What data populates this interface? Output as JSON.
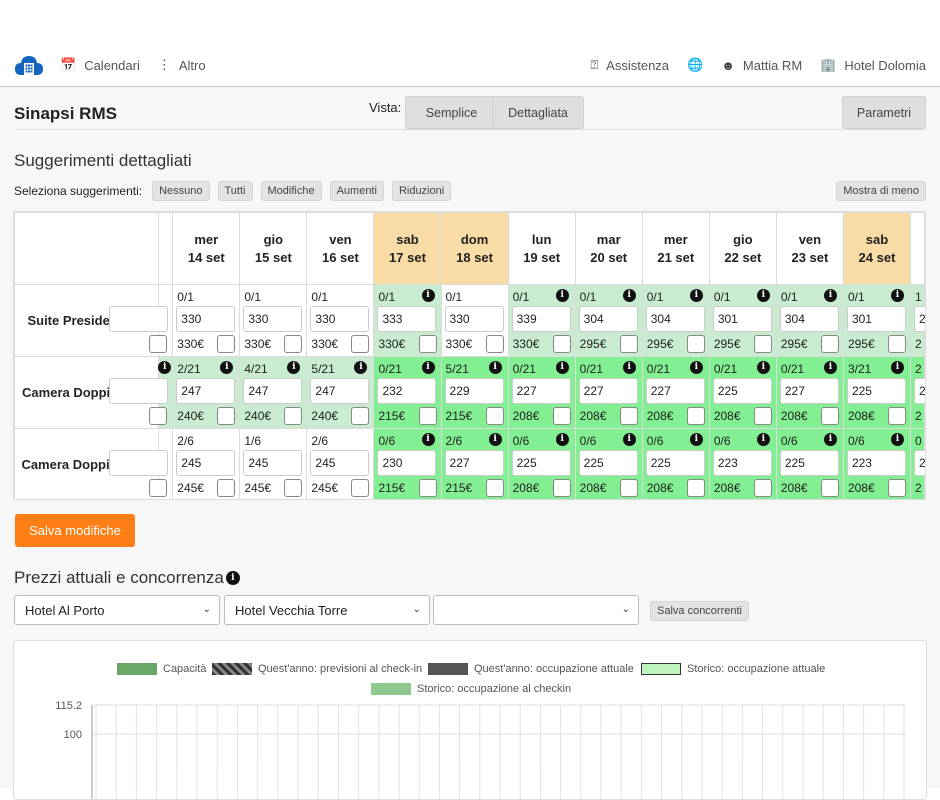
{
  "nav": {
    "calendari": "Calendari",
    "altro": "Altro",
    "assistenza": "Assistenza",
    "user": "Mattia RM",
    "hotel": "Hotel Dolomia"
  },
  "header": {
    "title": "Sinapsi RMS",
    "vista_label": "Vista:",
    "semplice": "Semplice",
    "dettagliata": "Dettagliata",
    "parametri": "Parametri"
  },
  "suggestions": {
    "title": "Suggerimenti dettagliati",
    "select_label": "Seleziona suggerimenti:",
    "filters": [
      "Nessuno",
      "Tutti",
      "Modifiche",
      "Aumenti",
      "Riduzioni"
    ],
    "show_less": "Mostra di meno"
  },
  "days": [
    {
      "dow": "mer",
      "date": "14 set",
      "weekend": false
    },
    {
      "dow": "gio",
      "date": "15 set",
      "weekend": false
    },
    {
      "dow": "ven",
      "date": "16 set",
      "weekend": false
    },
    {
      "dow": "sab",
      "date": "17 set",
      "weekend": true
    },
    {
      "dow": "dom",
      "date": "18 set",
      "weekend": true
    },
    {
      "dow": "lun",
      "date": "19 set",
      "weekend": false
    },
    {
      "dow": "mar",
      "date": "20 set",
      "weekend": false
    },
    {
      "dow": "mer",
      "date": "21 set",
      "weekend": false
    },
    {
      "dow": "gio",
      "date": "22 set",
      "weekend": false
    },
    {
      "dow": "ven",
      "date": "23 set",
      "weekend": false
    },
    {
      "dow": "sab",
      "date": "24 set",
      "weekend": true
    }
  ],
  "rooms": [
    {
      "name": "Suite Presidenziale",
      "left_occ": "",
      "left_cur": "",
      "left_info": false,
      "cells": [
        {
          "occ": "0/1",
          "price": "330",
          "cur": "330€",
          "tone": "white",
          "info": false
        },
        {
          "occ": "0/1",
          "price": "330",
          "cur": "330€",
          "tone": "white",
          "info": false
        },
        {
          "occ": "0/1",
          "price": "330",
          "cur": "330€",
          "tone": "white",
          "info": false
        },
        {
          "occ": "0/1",
          "price": "333",
          "cur": "330€",
          "tone": "light",
          "info": true
        },
        {
          "occ": "0/1",
          "price": "330",
          "cur": "330€",
          "tone": "white",
          "info": false
        },
        {
          "occ": "0/1",
          "price": "339",
          "cur": "330€",
          "tone": "light",
          "info": true
        },
        {
          "occ": "0/1",
          "price": "304",
          "cur": "295€",
          "tone": "light",
          "info": true
        },
        {
          "occ": "0/1",
          "price": "304",
          "cur": "295€",
          "tone": "light",
          "info": true
        },
        {
          "occ": "0/1",
          "price": "301",
          "cur": "295€",
          "tone": "light",
          "info": true
        },
        {
          "occ": "0/1",
          "price": "304",
          "cur": "295€",
          "tone": "light",
          "info": true
        },
        {
          "occ": "0/1",
          "price": "301",
          "cur": "295€",
          "tone": "light",
          "info": true
        }
      ],
      "partial": {
        "occ": "1",
        "price": "2",
        "cur": "2"
      }
    },
    {
      "name": "Camera Doppia Mare",
      "cells": [
        {
          "occ": "2/21",
          "price": "247",
          "cur": "240€",
          "tone": "light",
          "info": true
        },
        {
          "occ": "4/21",
          "price": "247",
          "cur": "240€",
          "tone": "light",
          "info": true
        },
        {
          "occ": "5/21",
          "price": "247",
          "cur": "240€",
          "tone": "light",
          "info": true
        },
        {
          "occ": "0/21",
          "price": "232",
          "cur": "215€",
          "tone": "bright",
          "info": true
        },
        {
          "occ": "5/21",
          "price": "229",
          "cur": "215€",
          "tone": "bright",
          "info": true
        },
        {
          "occ": "0/21",
          "price": "227",
          "cur": "208€",
          "tone": "bright",
          "info": true
        },
        {
          "occ": "0/21",
          "price": "227",
          "cur": "208€",
          "tone": "bright",
          "info": true
        },
        {
          "occ": "0/21",
          "price": "227",
          "cur": "208€",
          "tone": "bright",
          "info": true
        },
        {
          "occ": "0/21",
          "price": "225",
          "cur": "208€",
          "tone": "bright",
          "info": true
        },
        {
          "occ": "0/21",
          "price": "227",
          "cur": "208€",
          "tone": "bright",
          "info": true
        },
        {
          "occ": "3/21",
          "price": "225",
          "cur": "208€",
          "tone": "bright",
          "info": true
        }
      ],
      "partial": {
        "occ": "2",
        "price": "2",
        "cur": "2"
      }
    },
    {
      "name": "Camera Doppia Terra",
      "cells": [
        {
          "occ": "2/6",
          "price": "245",
          "cur": "245€",
          "tone": "white",
          "info": false
        },
        {
          "occ": "1/6",
          "price": "245",
          "cur": "245€",
          "tone": "white",
          "info": false
        },
        {
          "occ": "2/6",
          "price": "245",
          "cur": "245€",
          "tone": "white",
          "info": false
        },
        {
          "occ": "0/6",
          "price": "230",
          "cur": "215€",
          "tone": "bright",
          "info": true
        },
        {
          "occ": "2/6",
          "price": "227",
          "cur": "215€",
          "tone": "bright",
          "info": true
        },
        {
          "occ": "0/6",
          "price": "225",
          "cur": "208€",
          "tone": "bright",
          "info": true
        },
        {
          "occ": "0/6",
          "price": "225",
          "cur": "208€",
          "tone": "bright",
          "info": true
        },
        {
          "occ": "0/6",
          "price": "225",
          "cur": "208€",
          "tone": "bright",
          "info": true
        },
        {
          "occ": "0/6",
          "price": "223",
          "cur": "208€",
          "tone": "bright",
          "info": true
        },
        {
          "occ": "0/6",
          "price": "225",
          "cur": "208€",
          "tone": "bright",
          "info": true
        },
        {
          "occ": "0/6",
          "price": "223",
          "cur": "208€",
          "tone": "bright",
          "info": true
        }
      ],
      "partial": {
        "occ": "0",
        "price": "2",
        "cur": "2"
      }
    }
  ],
  "save_changes": "Salva modifiche",
  "competition": {
    "title": "Prezzi attuali e concorrenza",
    "select1": "Hotel Al Porto",
    "select2": "Hotel Vecchia Torre",
    "select3": "",
    "save": "Salva concorrenti"
  },
  "chart_data": {
    "type": "bar",
    "legend": [
      {
        "name": "Capacità",
        "color": "#6aa86a"
      },
      {
        "name": "Quest'anno: previsioni al check-in",
        "color": "#444444"
      },
      {
        "name": "Quest'anno: occupazione attuale",
        "color": "#555555"
      },
      {
        "name": "Storico: occupazione attuale",
        "color": "#bdf5bd"
      },
      {
        "name": "Storico: occupazione al checkin",
        "color": "#8fc98f"
      }
    ],
    "y_ticks": [
      "115.2",
      "100"
    ],
    "grid": true
  },
  "colors": {
    "accent_orange": "#fd7e14",
    "weekend": "#f9dca6",
    "green_light": "#c9ecd0",
    "green_bright": "#83ef93",
    "logo_blue": "#1565c0"
  }
}
